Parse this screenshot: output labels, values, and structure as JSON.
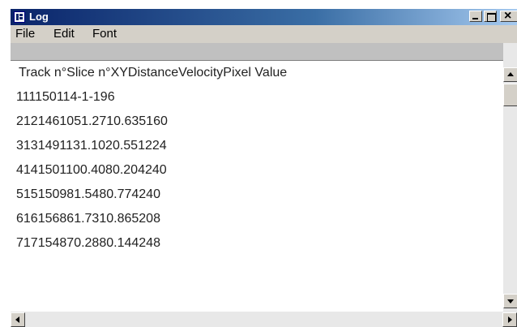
{
  "window": {
    "title": "Log",
    "controls": {
      "minimize": "minimize",
      "maximize": "maximize",
      "close": "close"
    }
  },
  "menubar": {
    "items": [
      "File",
      "Edit",
      "Font"
    ]
  },
  "log": {
    "header": "Track n°Slice n°XYDistanceVelocityPixel Value",
    "rows": [
      "111150114-1-196",
      "2121461051.2710.635160",
      "3131491131.1020.551224",
      "4141501100.4080.204240",
      "515150981.5480.774240",
      "616156861.7310.865208",
      "717154870.2880.144248"
    ]
  },
  "colors": {
    "titlebar_start": "#0a246a",
    "titlebar_end": "#a6caf0",
    "window_face": "#d4d0c8",
    "header_bar": "#c0c0c0"
  },
  "icons": {
    "app": "imagej-icon",
    "scroll_up": "arrow-up-icon",
    "scroll_down": "arrow-down-icon",
    "scroll_left": "arrow-left-icon",
    "scroll_right": "arrow-right-icon"
  }
}
